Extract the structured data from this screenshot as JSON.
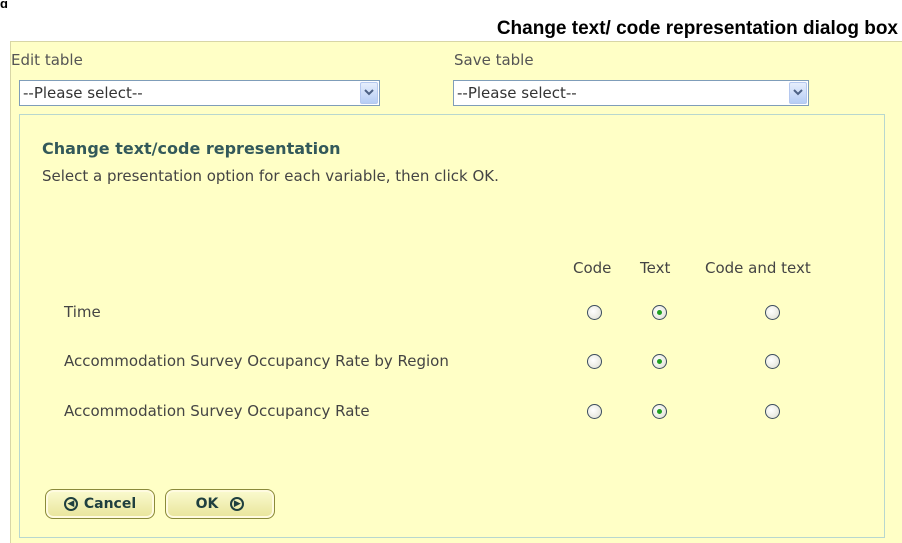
{
  "figure": {
    "corner_fragment": "g",
    "title": "Change text/ code representation dialog box"
  },
  "toolbar": {
    "edit_table_label": "Edit table",
    "edit_table_value": "--Please select--",
    "save_table_label": "Save table",
    "save_table_value": "--Please select--"
  },
  "dialog": {
    "heading": "Change text/code representation",
    "instructions": "Select a presentation option for each variable, then click OK.",
    "columns": [
      "Code",
      "Text",
      "Code and text"
    ],
    "rows": [
      {
        "label": "Time",
        "selected": "Text"
      },
      {
        "label": "Accommodation Survey Occupancy Rate by Region",
        "selected": "Text"
      },
      {
        "label": "Accommodation Survey Occupancy Rate",
        "selected": "Text"
      }
    ],
    "cancel_label": "Cancel",
    "ok_label": "OK"
  },
  "colors": {
    "panel_background": "#ffffc6",
    "heading": "#33595a",
    "radio_checked": "#21a121"
  }
}
